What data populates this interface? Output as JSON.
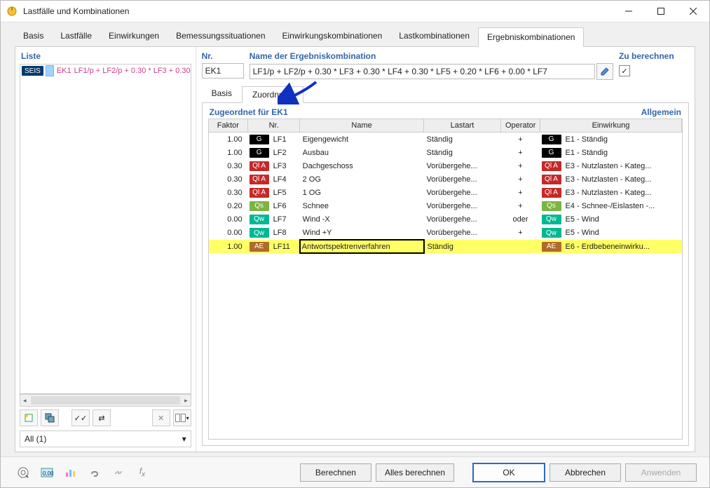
{
  "window": {
    "title": "Lastfälle und Kombinationen"
  },
  "main_tabs": {
    "items": [
      "Basis",
      "Lastfälle",
      "Einwirkungen",
      "Bemessungssituationen",
      "Einwirkungskombinationen",
      "Lastkombinationen",
      "Ergebniskombinationen"
    ],
    "active_index": 6
  },
  "left": {
    "header": "Liste",
    "row": {
      "badge": "SEIS",
      "code": "EK1",
      "text": "LF1/p + LF2/p + 0.30 * LF3 + 0.30"
    },
    "filter_label": "All (1)"
  },
  "nr": {
    "label": "Nr.",
    "value": "EK1"
  },
  "name": {
    "label": "Name der Ergebniskombination",
    "value": "LF1/p + LF2/p + 0.30 * LF3 + 0.30 * LF4 + 0.30 * LF5 + 0.20 * LF6 + 0.00 * LF7"
  },
  "calc": {
    "label": "Zu berechnen",
    "checked": true
  },
  "sub_tabs": {
    "items": [
      "Basis",
      "Zuordnung"
    ],
    "active_index": 1
  },
  "sub_header": {
    "left": "Zugeordnet für EK1",
    "right": "Allgemein"
  },
  "columns": {
    "faktor": "Faktor",
    "nr": "Nr.",
    "name": "Name",
    "lastart": "Lastart",
    "operator": "Operator",
    "einwirkung": "Einwirkung"
  },
  "rows": [
    {
      "faktor": "1.00",
      "badge": "G",
      "badge_cls": "badge-g",
      "nr": "LF1",
      "name": "Eigengewicht",
      "lastart": "Ständig",
      "op": "+",
      "badge2": "G",
      "badge2_cls": "badge-g",
      "einw": "E1 - Ständig"
    },
    {
      "faktor": "1.00",
      "badge": "G",
      "badge_cls": "badge-g",
      "nr": "LF2",
      "name": "Ausbau",
      "lastart": "Ständig",
      "op": "+",
      "badge2": "G",
      "badge2_cls": "badge-g",
      "einw": "E1 - Ständig"
    },
    {
      "faktor": "0.30",
      "badge": "Ql A",
      "badge_cls": "badge-qia",
      "nr": "LF3",
      "name": "Dachgeschoss",
      "lastart": "Vorübergehe...",
      "op": "+",
      "badge2": "Ql A",
      "badge2_cls": "badge-qia",
      "einw": "E3 - Nutzlasten - Kateg..."
    },
    {
      "faktor": "0.30",
      "badge": "Ql A",
      "badge_cls": "badge-qia",
      "nr": "LF4",
      "name": "2 OG",
      "lastart": "Vorübergehe...",
      "op": "+",
      "badge2": "Ql A",
      "badge2_cls": "badge-qia",
      "einw": "E3 - Nutzlasten - Kateg..."
    },
    {
      "faktor": "0.30",
      "badge": "Ql A",
      "badge_cls": "badge-qia",
      "nr": "LF5",
      "name": "1 OG",
      "lastart": "Vorübergehe...",
      "op": "+",
      "badge2": "Ql A",
      "badge2_cls": "badge-qia",
      "einw": "E3 - Nutzlasten - Kateg..."
    },
    {
      "faktor": "0.20",
      "badge": "Qs",
      "badge_cls": "badge-qs",
      "nr": "LF6",
      "name": "Schnee",
      "lastart": "Vorübergehe...",
      "op": "+",
      "badge2": "Qs",
      "badge2_cls": "badge-qs",
      "einw": "E4 - Schnee-/Eislasten -..."
    },
    {
      "faktor": "0.00",
      "badge": "Qw",
      "badge_cls": "badge-qw",
      "nr": "LF7",
      "name": "Wind -X",
      "lastart": "Vorübergehe...",
      "op": "oder",
      "badge2": "Qw",
      "badge2_cls": "badge-qw",
      "einw": "E5 - Wind"
    },
    {
      "faktor": "0.00",
      "badge": "Qw",
      "badge_cls": "badge-qw",
      "nr": "LF8",
      "name": "Wind +Y",
      "lastart": "Vorübergehe...",
      "op": "+",
      "badge2": "Qw",
      "badge2_cls": "badge-qw",
      "einw": "E5 - Wind"
    },
    {
      "faktor": "1.00",
      "badge": "AE",
      "badge_cls": "badge-ae",
      "nr": "LF11",
      "name": "Antwortspektrenverfahren",
      "lastart": "Ständig",
      "op": "",
      "badge2": "AE",
      "badge2_cls": "badge-ae",
      "einw": "E6 - Erdbebeneinwirku...",
      "highlight": true,
      "selected_cell": "name"
    }
  ],
  "buttons": {
    "calculate": "Berechnen",
    "calc_all": "Alles berechnen",
    "ok": "OK",
    "cancel": "Abbrechen",
    "apply": "Anwenden"
  }
}
